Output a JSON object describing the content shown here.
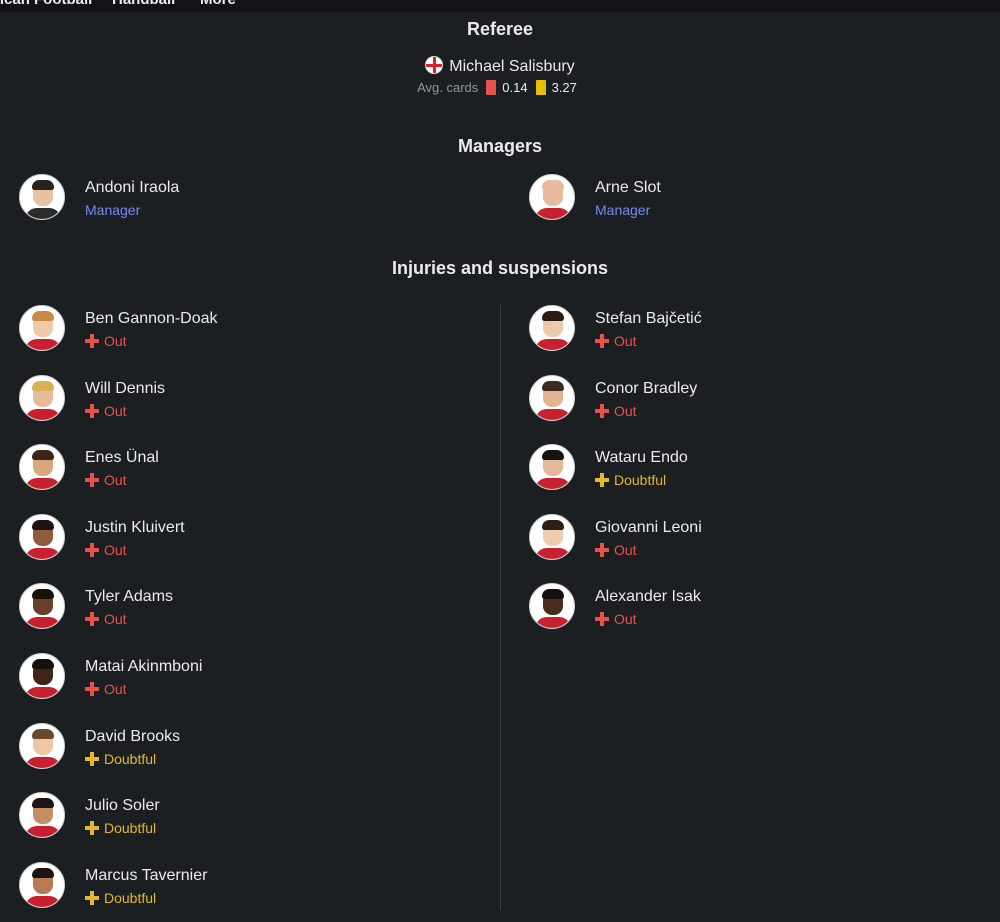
{
  "nav": {
    "items": [
      "rican Football",
      "Handball",
      "More"
    ]
  },
  "referee": {
    "title": "Referee",
    "name": "Michael Salisbury",
    "flag": "england-flag-icon",
    "avg_cards_label": "Avg. cards",
    "red_avg": "0.14",
    "yellow_avg": "3.27"
  },
  "managers": {
    "title": "Managers",
    "items": [
      {
        "name": "Andoni Iraola",
        "role": "Manager"
      },
      {
        "name": "Arne Slot",
        "role": "Manager"
      }
    ]
  },
  "injuries": {
    "title": "Injuries and suspensions",
    "home": [
      {
        "name": "Ben Gannon-Doak",
        "status": "Out"
      },
      {
        "name": "Will Dennis",
        "status": "Out"
      },
      {
        "name": "Enes Ünal",
        "status": "Out"
      },
      {
        "name": "Justin Kluivert",
        "status": "Out"
      },
      {
        "name": "Tyler Adams",
        "status": "Out"
      },
      {
        "name": "Matai Akinmboni",
        "status": "Out"
      },
      {
        "name": "David Brooks",
        "status": "Doubtful"
      },
      {
        "name": "Julio Soler",
        "status": "Doubtful"
      },
      {
        "name": "Marcus Tavernier",
        "status": "Doubtful"
      }
    ],
    "away": [
      {
        "name": "Stefan Bajčetić",
        "status": "Out"
      },
      {
        "name": "Conor Bradley",
        "status": "Out"
      },
      {
        "name": "Wataru Endo",
        "status": "Doubtful"
      },
      {
        "name": "Giovanni Leoni",
        "status": "Out"
      },
      {
        "name": "Alexander Isak",
        "status": "Out"
      }
    ]
  },
  "colors": {
    "background": "#1c1f22",
    "out": "#e5534b",
    "doubtful": "#e5b82a",
    "manager_role": "#7a86f0"
  }
}
